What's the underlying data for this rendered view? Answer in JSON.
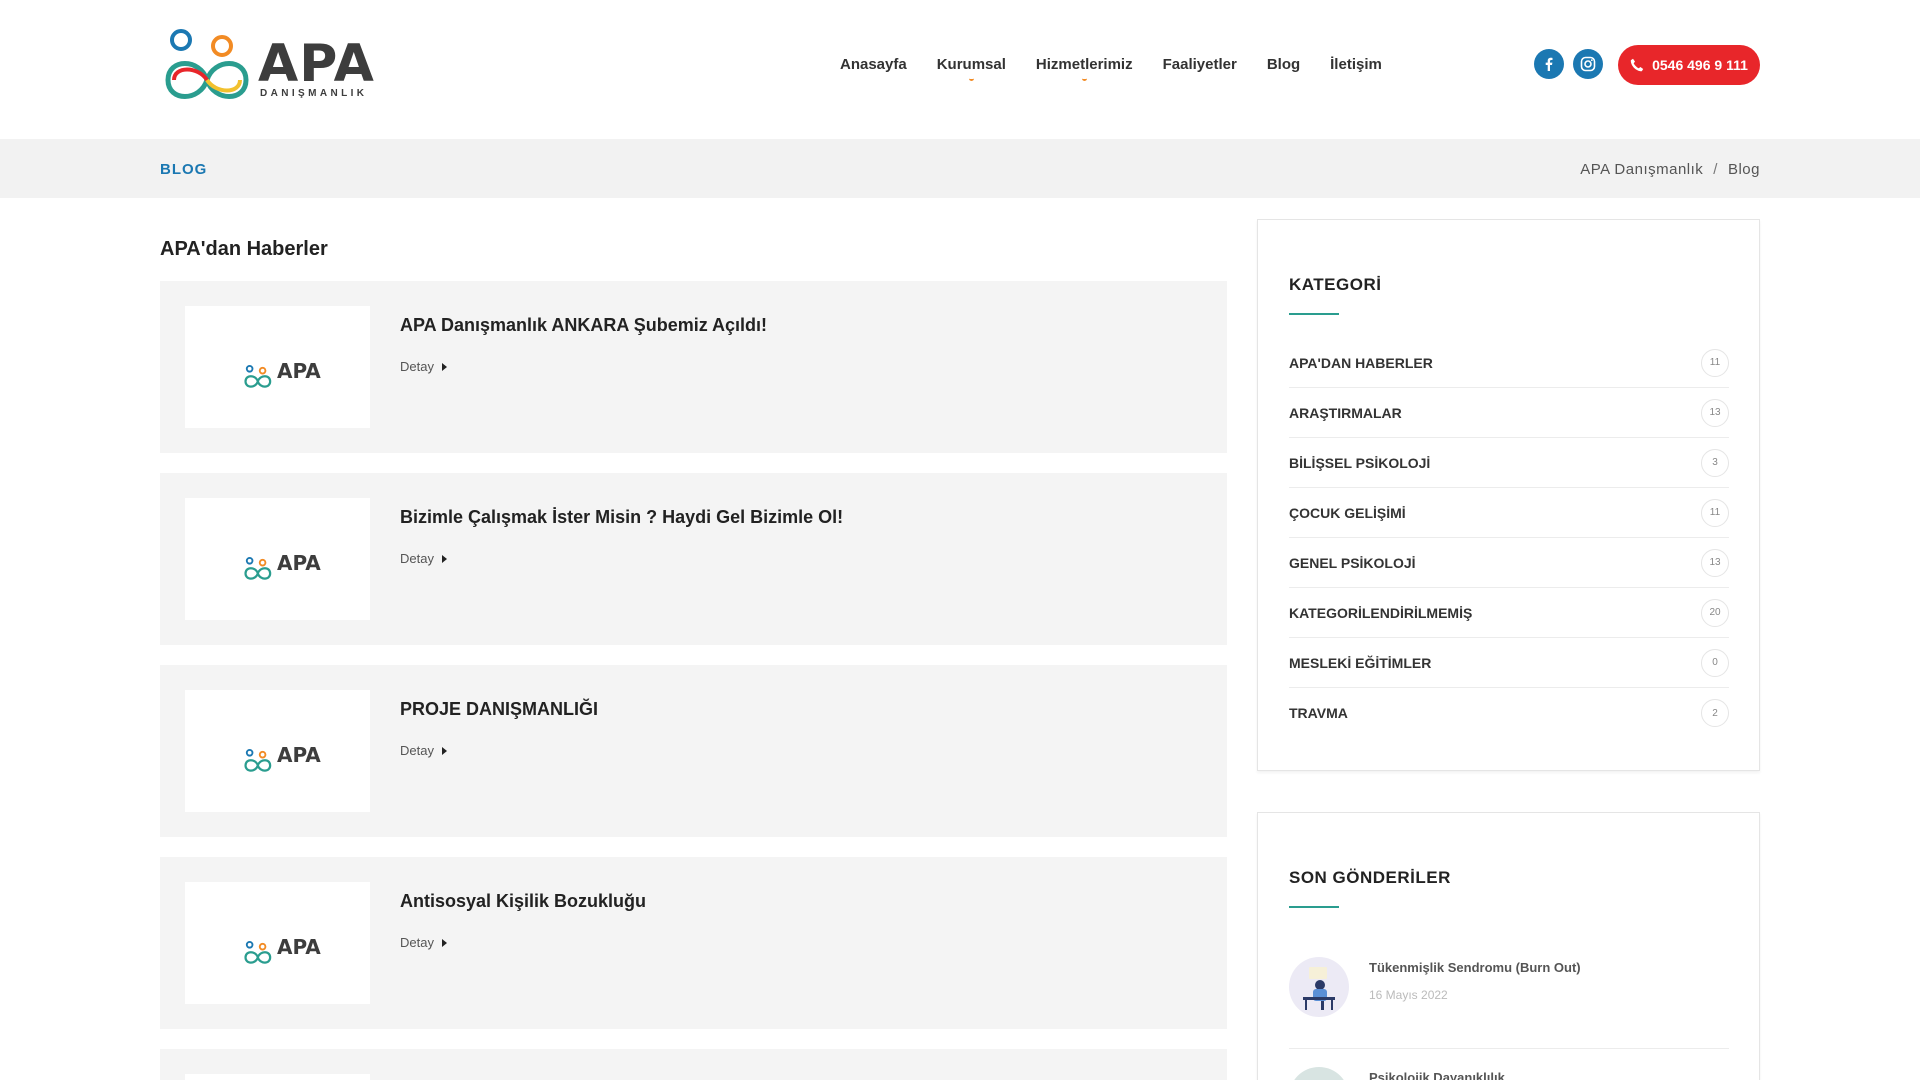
{
  "brand": {
    "name": "APA",
    "subtitle": "DANIŞMANLIK"
  },
  "nav": [
    {
      "label": "Anasayfa",
      "has_sub": false
    },
    {
      "label": "Kurumsal",
      "has_sub": true
    },
    {
      "label": "Hizmetlerimiz",
      "has_sub": true
    },
    {
      "label": "Faaliyetler",
      "has_sub": false
    },
    {
      "label": "Blog",
      "has_sub": false
    },
    {
      "label": "İletişim",
      "has_sub": false
    }
  ],
  "header": {
    "phone": "0546 496 9 111"
  },
  "breadcrumb": {
    "title": "BLOG",
    "home": "APA Danışmanlık",
    "separator": "/",
    "current": "Blog"
  },
  "main": {
    "section_title": "APA'dan Haberler",
    "thumb_label": "APA",
    "read_more": "Detay",
    "posts": [
      {
        "title": "APA Danışmanlık ANKARA Şubemiz Açıldı!"
      },
      {
        "title": "Bizimle Çalışmak İster Misin ? Haydi Gel Bizimle Ol!"
      },
      {
        "title": "PROJE DANIŞMANLIĞI"
      },
      {
        "title": "Antisosyal Kişilik Bozukluğu"
      }
    ]
  },
  "sidebar": {
    "categories_title": "KATEGORİ",
    "categories": [
      {
        "name": "APA'DAN HABERLER",
        "count": "11"
      },
      {
        "name": "ARAŞTIRMALAR",
        "count": "13"
      },
      {
        "name": "BİLİŞSEL PSİKOLOJİ",
        "count": "3"
      },
      {
        "name": "ÇOCUK GELİŞİMİ",
        "count": "11"
      },
      {
        "name": "GENEL PSİKOLOJİ",
        "count": "13"
      },
      {
        "name": "KATEGORİLENDİRİLMEMİŞ",
        "count": "20"
      },
      {
        "name": "MESLEKİ EĞİTİMLER",
        "count": "0"
      },
      {
        "name": "TRAVMA",
        "count": "2"
      }
    ],
    "recent_title": "SON GÖNDERİLER",
    "recent": [
      {
        "title": "Tükenmişlik Sendromu (Burn Out)",
        "date": "16 Mayıs 2022"
      },
      {
        "title": "Psikolojik Dayanıklılık",
        "date": ""
      }
    ]
  },
  "colors": {
    "accent_blue": "#1b78b2",
    "phone_red": "#e8262a",
    "widget_line": "#2a9d8f",
    "nav_dot": "#f28b24"
  }
}
